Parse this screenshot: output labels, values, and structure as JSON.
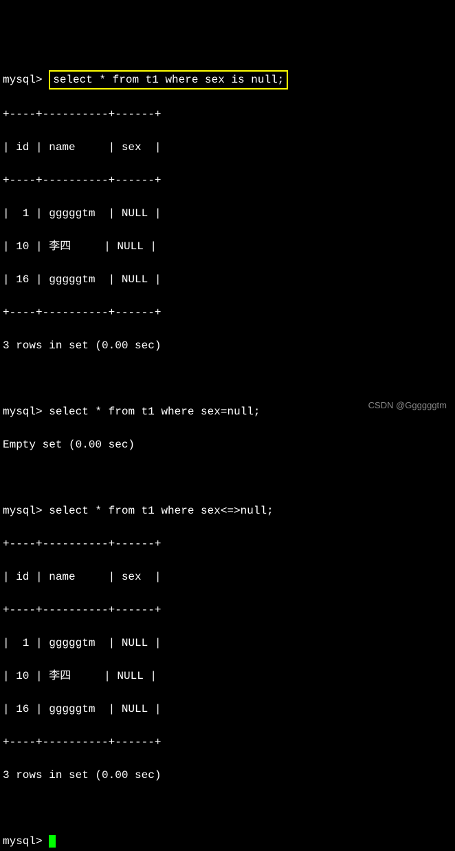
{
  "prompt": "mysql>",
  "queries": {
    "q1": "select * from t1 where sex is null;",
    "q2": "select * from t1 where sex=null;",
    "q3": "select * from t1 where sex<=>null;"
  },
  "table": {
    "border": "+----+----------+------+",
    "header": "| id | name     | sex  |",
    "rows": [
      "|  1 | gggggtm  | NULL |",
      "| 10 | 李四     | NULL |",
      "| 16 | gggggtm  | NULL |"
    ]
  },
  "chart_data": {
    "type": "table",
    "columns": [
      "id",
      "name",
      "sex"
    ],
    "rows_q1": [
      {
        "id": 1,
        "name": "gggggtm",
        "sex": null
      },
      {
        "id": 10,
        "name": "李四",
        "sex": null
      },
      {
        "id": 16,
        "name": "gggggtm",
        "sex": null
      }
    ],
    "rows_q3": [
      {
        "id": 1,
        "name": "gggggtm",
        "sex": null
      },
      {
        "id": 10,
        "name": "李四",
        "sex": null
      },
      {
        "id": 16,
        "name": "gggggtm",
        "sex": null
      }
    ]
  },
  "results": {
    "rows3": "3 rows in set (0.00 sec)",
    "empty": "Empty set (0.00 sec)"
  },
  "watermark": "CSDN @Ggggggtm"
}
